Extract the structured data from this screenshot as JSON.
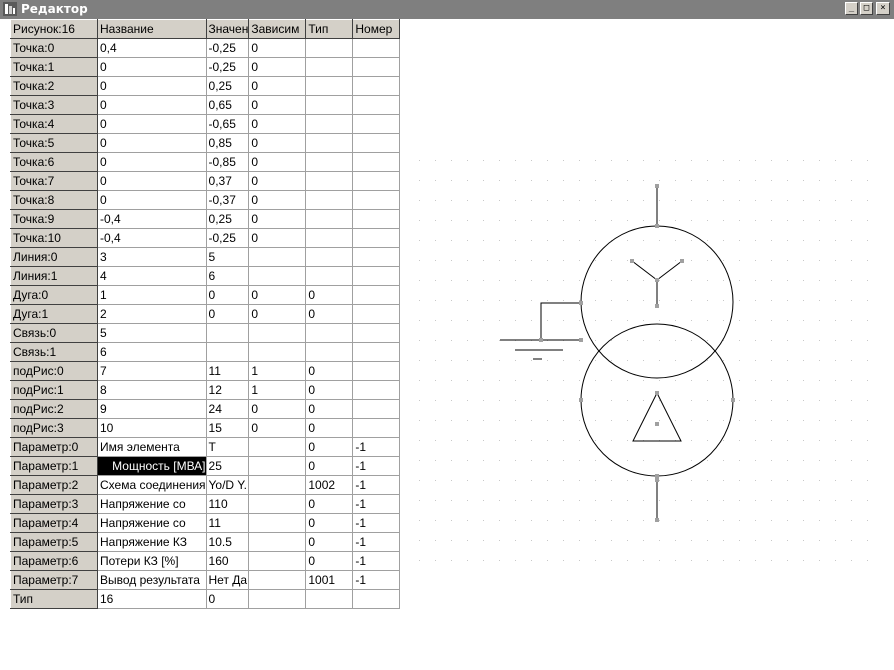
{
  "window": {
    "title": "Редактор",
    "minimize_glyph": "_",
    "maximize_glyph": "□",
    "close_glyph": "×"
  },
  "grid": {
    "headers": [
      "Рисунок:16",
      "Название",
      "Значен",
      "Зависим",
      "Тип",
      "Номер"
    ],
    "rows": [
      [
        "Точка:0",
        "0,4",
        "-0,25",
        "0",
        "",
        ""
      ],
      [
        "Точка:1",
        "0",
        "-0,25",
        "0",
        "",
        ""
      ],
      [
        "Точка:2",
        "0",
        "0,25",
        "0",
        "",
        ""
      ],
      [
        "Точка:3",
        "0",
        "0,65",
        "0",
        "",
        ""
      ],
      [
        "Точка:4",
        "0",
        "-0,65",
        "0",
        "",
        ""
      ],
      [
        "Точка:5",
        "0",
        "0,85",
        "0",
        "",
        ""
      ],
      [
        "Точка:6",
        "0",
        "-0,85",
        "0",
        "",
        ""
      ],
      [
        "Точка:7",
        "0",
        "0,37",
        "0",
        "",
        ""
      ],
      [
        "Точка:8",
        "0",
        "-0,37",
        "0",
        "",
        ""
      ],
      [
        "Точка:9",
        "-0,4",
        "0,25",
        "0",
        "",
        ""
      ],
      [
        "Точка:10",
        "-0,4",
        "-0,25",
        "0",
        "",
        ""
      ],
      [
        "Линия:0",
        "3",
        "5",
        "",
        "",
        ""
      ],
      [
        "Линия:1",
        "4",
        "6",
        "",
        "",
        ""
      ],
      [
        "Дуга:0",
        "1",
        "0",
        "0",
        "0",
        ""
      ],
      [
        "Дуга:1",
        "2",
        "0",
        "0",
        "0",
        ""
      ],
      [
        "Связь:0",
        "5",
        "",
        "",
        "",
        ""
      ],
      [
        "Связь:1",
        "6",
        "",
        "",
        "",
        ""
      ],
      [
        "подРис:0",
        "7",
        "11",
        "1",
        "0",
        ""
      ],
      [
        "подРис:1",
        "8",
        "12",
        "1",
        "0",
        ""
      ],
      [
        "подРис:2",
        "9",
        "24",
        "0",
        "0",
        ""
      ],
      [
        "подРис:3",
        "10",
        "15",
        "0",
        "0",
        ""
      ],
      [
        "Параметр:0",
        "Имя элемента",
        "Т",
        "",
        "0",
        "-1"
      ],
      [
        "Параметр:1",
        "Мощность [МВА]",
        "25",
        "",
        "0",
        "-1"
      ],
      [
        "Параметр:2",
        "Схема соединения",
        "Yo/D Y.",
        "",
        "1002",
        "-1"
      ],
      [
        "Параметр:3",
        "Напряжение со",
        "110",
        "",
        "0",
        "-1"
      ],
      [
        "Параметр:4",
        "Напряжение со",
        "11",
        "",
        "0",
        "-1"
      ],
      [
        "Параметр:5",
        "Напряжение КЗ",
        "10.5",
        "",
        "0",
        "-1"
      ],
      [
        "Параметр:6",
        "Потери КЗ [%]",
        "160",
        "",
        "0",
        "-1"
      ],
      [
        "Параметр:7",
        "Вывод результата",
        "Нет Да",
        "",
        "1001",
        "-1"
      ],
      [
        "Тип",
        "16",
        "0",
        "",
        "",
        ""
      ]
    ]
  },
  "canvas": {
    "symbol": "two-winding-transformer",
    "winding_top": "star",
    "winding_bottom": "delta",
    "line_color": "#000000",
    "handle_color": "#a0a0a0",
    "grid_dot_color": "#c8c8c8"
  }
}
